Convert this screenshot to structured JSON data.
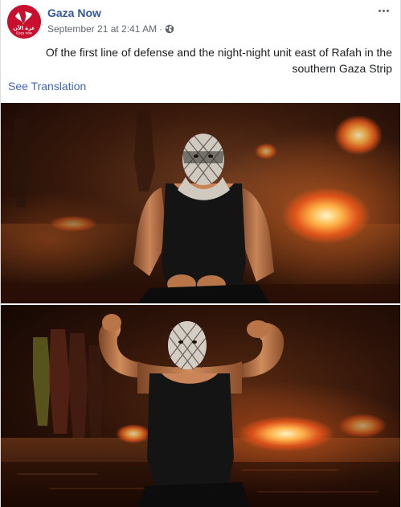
{
  "post": {
    "page_name": "Gaza Now",
    "timestamp": "September 21 at 2:41 AM",
    "separator": "·",
    "privacy_icon": "globe-icon",
    "more_icon": "more-options-icon",
    "text": "Of the first line of defense and the night-night unit east of Rafah in the southern Gaza Strip",
    "see_translation": "See Translation"
  },
  "avatar": {
    "logo_text_arabic": "غزة الآن",
    "logo_text_latin": "Gaza now",
    "background_color": "#c8102e"
  },
  "photos": [
    {
      "subject": "masked man in black tank top crouching in front of fires at night"
    },
    {
      "subject": "masked man flexing both arms in front of fires with people in the background"
    }
  ],
  "colors": {
    "link": "#365899",
    "secondary_link": "#4267b2",
    "meta": "#606770",
    "text": "#1c1e21"
  }
}
